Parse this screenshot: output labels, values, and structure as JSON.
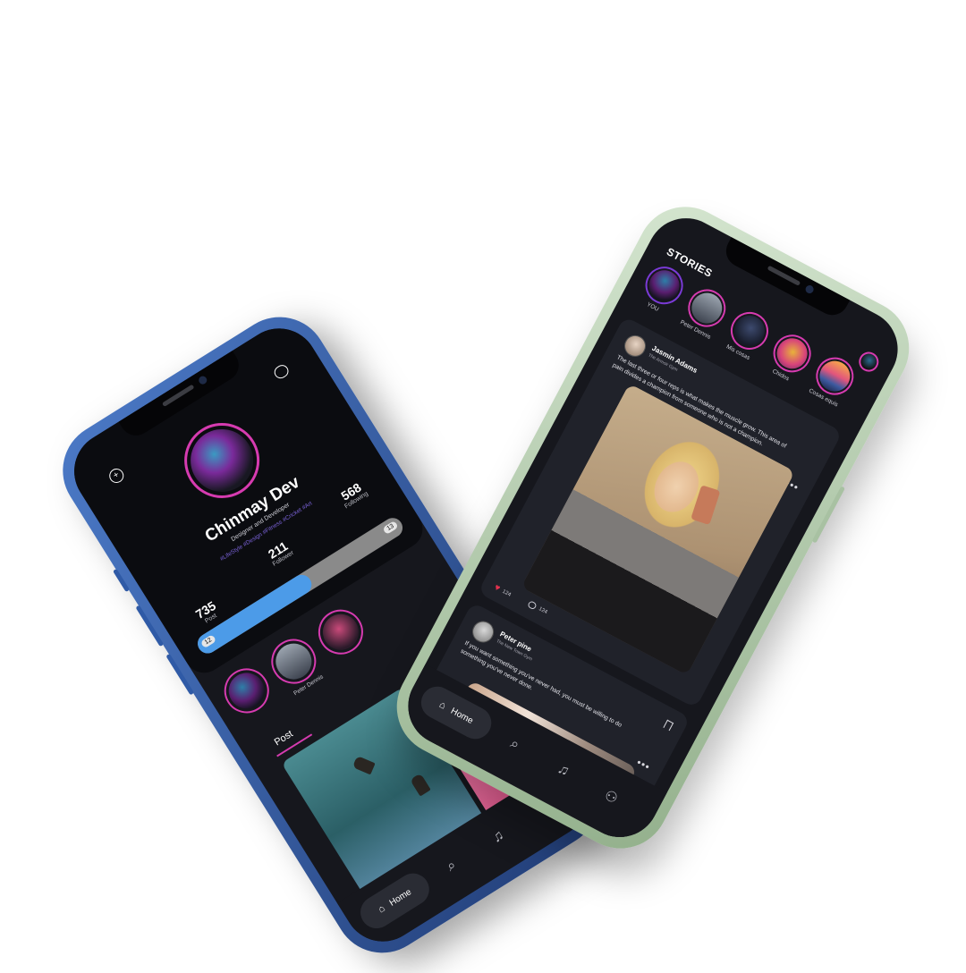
{
  "feed_app": {
    "stories_title": "STORIES",
    "stories": [
      {
        "label": "YOU"
      },
      {
        "label": "Peter Dennis"
      },
      {
        "label": "Mis cosas"
      },
      {
        "label": "Chidos"
      },
      {
        "label": "Cosas equis"
      }
    ],
    "posts": [
      {
        "author": "Jasmin Adams",
        "subtitle": "The Armoir Gym",
        "text": "The last three or four reps is what makes the muscle grow. This area of pain divides a champion from someone who is not a champion.",
        "likes": "124",
        "comments": "124"
      },
      {
        "author": "Peter pine",
        "subtitle": "The New Town Gym",
        "text": "If you want something you've never had, you must be willing to do something you've never done."
      }
    ],
    "nav": {
      "home_label": "Home"
    }
  },
  "profile_app": {
    "name": "Chinmay Dev",
    "role": "Designer and Developer",
    "tags": "#LifeStyle #Design #Fitness #Cricket #Art",
    "stats": [
      {
        "value": "735",
        "label": "Post"
      },
      {
        "value": "211",
        "label": "Follower"
      },
      {
        "value": "568",
        "label": "Following"
      }
    ],
    "level": {
      "current": "12",
      "next": "13",
      "progress": 0.55
    },
    "stories": [
      {
        "label": ""
      },
      {
        "label": "Peter Dennis"
      },
      {
        "label": ""
      }
    ],
    "tabs": [
      "Post"
    ],
    "nav": {
      "home_label": "Home"
    }
  },
  "colors": {
    "accent_pink": "#d63bb0",
    "accent_blue": "#4c9be8",
    "screen_bg": "#16171d",
    "card_bg": "#20222a"
  }
}
